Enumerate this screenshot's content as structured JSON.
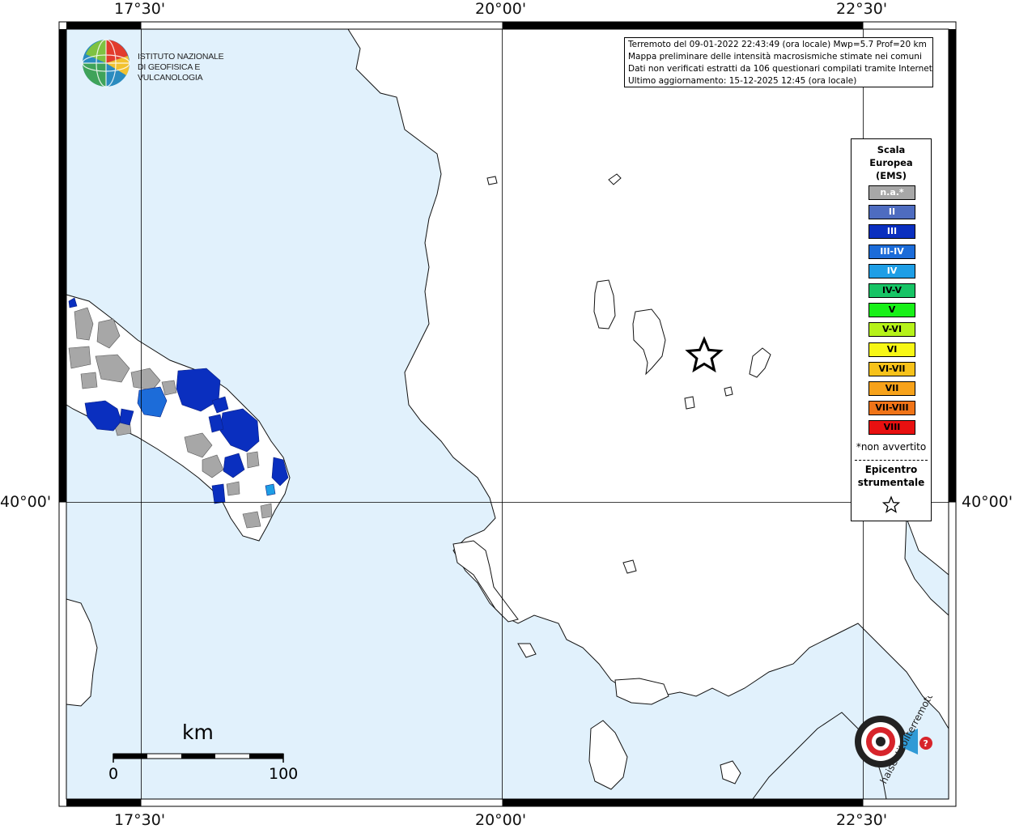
{
  "map": {
    "lon_ticks_top": [
      "17°30'",
      "20°00'",
      "22°30'"
    ],
    "lon_ticks_bottom": [
      "17°30'",
      "20°00'",
      "22°30'"
    ],
    "lat_tick_left": "40°00'",
    "lat_tick_right": "40°00'",
    "colors": {
      "sea": "#e1f1fc",
      "land": "#ffffff",
      "not_felt": "#a7a7a7",
      "iii": "#0a2fbf",
      "iii_iv": "#1c6cd9",
      "iv": "#1e9ee6"
    }
  },
  "logo": {
    "line1": "ISTITUTO NAZIONALE",
    "line2": "DI GEOFISICA E VULCANOLOGIA",
    "icon": "ingv-globe-logo"
  },
  "info": {
    "line1": "Terremoto del 09-01-2022 22:43:49 (ora locale) Mwp=5.7 Prof=20 km",
    "line2": "Mappa preliminare delle intensità macrosismiche stimate nei comuni",
    "line3": "Dati non verificati estratti da 106 questionari compilati tramite Internet.",
    "line4": "Ultimo aggiornamento: 15-12-2025 12:45 (ora locale)"
  },
  "legend": {
    "title1": "Scala",
    "title2": "Europea",
    "title3": "(EMS)",
    "items": [
      {
        "label": "n.a.*",
        "color": "#a7a7a7",
        "text_color": "#ffffff"
      },
      {
        "label": "II",
        "color": "#4e6cc0",
        "text_color": "#ffffff"
      },
      {
        "label": "III",
        "color": "#0a2fbf",
        "text_color": "#ffffff"
      },
      {
        "label": "III-IV",
        "color": "#1c6cd9",
        "text_color": "#ffffff"
      },
      {
        "label": "IV",
        "color": "#1e9ee6",
        "text_color": "#ffffff"
      },
      {
        "label": "IV-V",
        "color": "#17c465",
        "text_color": "#000000"
      },
      {
        "label": "V",
        "color": "#18f018",
        "text_color": "#000000"
      },
      {
        "label": "V-VI",
        "color": "#b6f21a",
        "text_color": "#000000"
      },
      {
        "label": "VI",
        "color": "#f7f716",
        "text_color": "#000000"
      },
      {
        "label": "VI-VII",
        "color": "#f7c21a",
        "text_color": "#000000"
      },
      {
        "label": "VII",
        "color": "#f7a21a",
        "text_color": "#000000"
      },
      {
        "label": "VII-VIII",
        "color": "#f07418",
        "text_color": "#000000"
      },
      {
        "label": "VIII",
        "color": "#e81010",
        "text_color": "#000000"
      }
    ],
    "note": "*non avvertito",
    "epicenter1": "Epicentro",
    "epicenter2": "strumentale"
  },
  "scalebar": {
    "unit": "km",
    "label_start": "0",
    "label_end": "100"
  },
  "badge": {
    "text": "haisentitoilterremoto.it",
    "icon": "hai-sentito-il-terremoto-logo"
  }
}
